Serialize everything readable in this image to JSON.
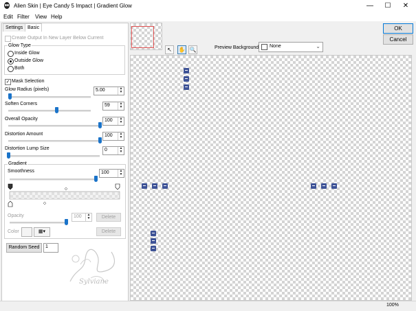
{
  "window": {
    "title": "Alien Skin | Eye Candy 5 Impact | Gradient Glow",
    "minimize_icon": "minimize-icon",
    "maximize_icon": "maximize-icon",
    "close_icon": "close-icon"
  },
  "menu": [
    "Edit",
    "Filter",
    "View",
    "Help"
  ],
  "tabs": [
    "Settings",
    "Basic"
  ],
  "basic": {
    "create_output_label": "Create Output In New Layer Below Current",
    "glow_type_label": "Glow Type",
    "glow_types": [
      "Inside Glow",
      "Outside Glow",
      "Both"
    ],
    "glow_type_selected": "Outside Glow",
    "mask_selection_label": "Mask Selection",
    "glow_radius_label": "Glow Radius (pixels)",
    "glow_radius": "5.00",
    "soften_corners_label": "Soften Corners",
    "soften_corners": "59",
    "overall_opacity_label": "Overall Opacity",
    "overall_opacity": "100",
    "distortion_amount_label": "Distortion Amount",
    "distortion_amount": "100",
    "distortion_lump_label": "Distortion Lump Size",
    "distortion_lump": "0",
    "gradient_label": "Gradient",
    "smoothness_label": "Smoothness",
    "smoothness": "100",
    "opacity_label": "Opacity",
    "opacity_value": "100",
    "delete_label": "Delete",
    "color_label": "Color",
    "random_seed_label": "Random Seed",
    "random_seed": "1"
  },
  "slider_levels": {
    "glow_radius": 0.02,
    "soften_corners": 0.59,
    "overall_opacity": 1.0,
    "distortion_amount": 1.0,
    "distortion_lump": 0.0,
    "smoothness": 1.0,
    "opacity": 1.0
  },
  "watermark": "Sylviane",
  "buttons": {
    "ok": "OK",
    "cancel": "Cancel"
  },
  "preview": {
    "background_label": "Preview Background:",
    "background_value": "None",
    "zoom": "100%"
  },
  "colors": {
    "accent": "#1a73c9",
    "marker": "#3d5296",
    "thumb_frame": "#e05050"
  }
}
